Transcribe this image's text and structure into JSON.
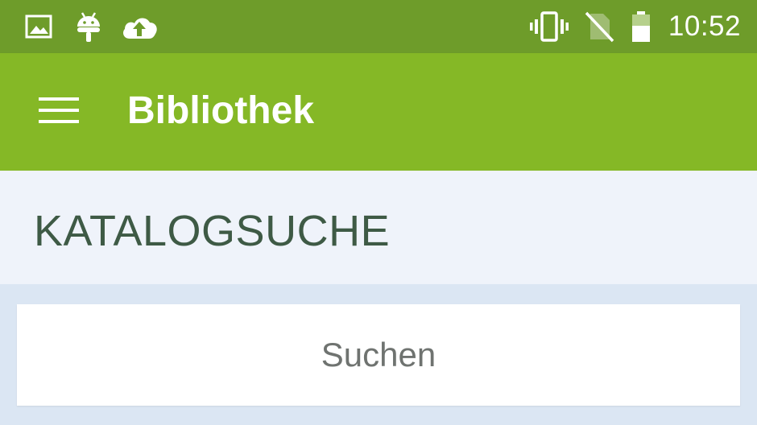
{
  "status_bar": {
    "time": "10:52",
    "icons": [
      "image-icon",
      "android-icon",
      "cloud-upload-icon",
      "vibrate-icon",
      "no-sim-icon",
      "battery-icon"
    ],
    "color": "#6e9c2a"
  },
  "app_bar": {
    "title": "Bibliothek",
    "menu_icon": "hamburger-menu-icon",
    "color": "#85b826"
  },
  "section": {
    "title": "KATALOGSUCHE",
    "color": "#eff3fa"
  },
  "search": {
    "button_label": "Suchen"
  }
}
